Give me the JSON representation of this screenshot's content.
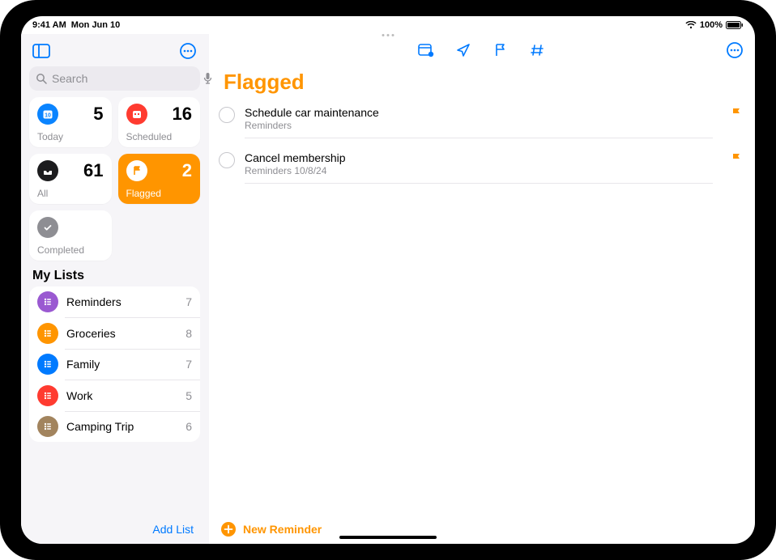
{
  "statusbar": {
    "time": "9:41 AM",
    "date": "Mon Jun 10",
    "battery": "100%"
  },
  "sidebar": {
    "search_placeholder": "Search",
    "smart": {
      "today": {
        "label": "Today",
        "count": 5
      },
      "scheduled": {
        "label": "Scheduled",
        "count": 16
      },
      "all": {
        "label": "All",
        "count": 61
      },
      "flagged": {
        "label": "Flagged",
        "count": 2
      },
      "completed": {
        "label": "Completed"
      }
    },
    "section_title": "My Lists",
    "lists": [
      {
        "name": "Reminders",
        "count": 7,
        "color": "#9a59d1"
      },
      {
        "name": "Groceries",
        "count": 8,
        "color": "#ff9500"
      },
      {
        "name": "Family",
        "count": 7,
        "color": "#007aff"
      },
      {
        "name": "Work",
        "count": 5,
        "color": "#ff3b30"
      },
      {
        "name": "Camping Trip",
        "count": 6,
        "color": "#a2845e"
      }
    ],
    "add_list_label": "Add List"
  },
  "main": {
    "title": "Flagged",
    "reminders": [
      {
        "title": "Schedule car maintenance",
        "subtitle": "Reminders"
      },
      {
        "title": "Cancel membership",
        "subtitle": "Reminders  10/8/24"
      }
    ],
    "new_reminder_label": "New Reminder"
  },
  "colors": {
    "accent_blue": "#007aff",
    "accent_orange": "#ff9500",
    "today": "#0a84ff",
    "scheduled": "#ff3b30",
    "all": "#1c1c1e",
    "completed": "#8e8e93"
  }
}
